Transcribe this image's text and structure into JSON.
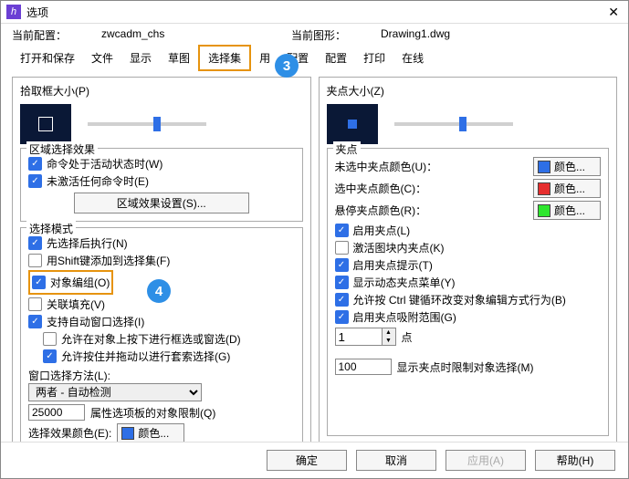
{
  "title": "选项",
  "config_label": "当前配置：",
  "config_value": "zwcadm_chs",
  "drawing_label": "当前图形：",
  "drawing_value": "Drawing1.dwg",
  "tabs": {
    "t0": "打开和保存",
    "t1": "文件",
    "t2": "显示",
    "t3": "草图",
    "t4": "选择集",
    "t5": "用",
    "t6": "配置",
    "t7": "配置",
    "t8": "打印",
    "t9": "在线"
  },
  "badge3": "3",
  "badge4": "4",
  "left": {
    "pickbox_title": "拾取框大小(P)",
    "region_title": "区域选择效果",
    "region_c1": "命令处于活动状态时(W)",
    "region_c2": "未激活任何命令时(E)",
    "region_btn": "区域效果设置(S)...",
    "selmode_title": "选择模式",
    "sm1": "先选择后执行(N)",
    "sm2": "用Shift键添加到选择集(F)",
    "sm3": "对象编组(O)",
    "sm4": "关联填充(V)",
    "sm5": "支持自动窗口选择(I)",
    "sm5a": "允许在对象上按下进行框选或窗选(D)",
    "sm5b": "允许按住并拖动以进行套索选择(G)",
    "winsel_label": "窗口选择方法(L):",
    "winsel_value": "两者 - 自动检测",
    "limit_value": "25000",
    "limit_label": "属性选项板的对象限制(Q)",
    "selcolor_label": "选择效果颜色(E):",
    "selcolor_btn": "颜色..."
  },
  "right": {
    "grip_title": "夹点大小(Z)",
    "grip_group": "夹点",
    "unsel_label": "未选中夹点颜色(U)：",
    "unsel_btn": "颜色...",
    "sel_label": "选中夹点颜色(C)：",
    "sel_btn": "颜色...",
    "hover_label": "悬停夹点颜色(R)：",
    "hover_btn": "颜色...",
    "g1": "启用夹点(L)",
    "g2": "激活图块内夹点(K)",
    "g3": "启用夹点提示(T)",
    "g4": "显示动态夹点菜单(Y)",
    "g5": "允许按 Ctrl 键循环改变对象编辑方式行为(B)",
    "g6": "启用夹点吸附范围(G)",
    "snap_value": "1",
    "snap_label": "点",
    "disp_value": "100",
    "disp_label": "显示夹点时限制对象选择(M)"
  },
  "footer": {
    "ok": "确定",
    "cancel": "取消",
    "apply": "应用(A)",
    "help": "帮助(H)"
  }
}
